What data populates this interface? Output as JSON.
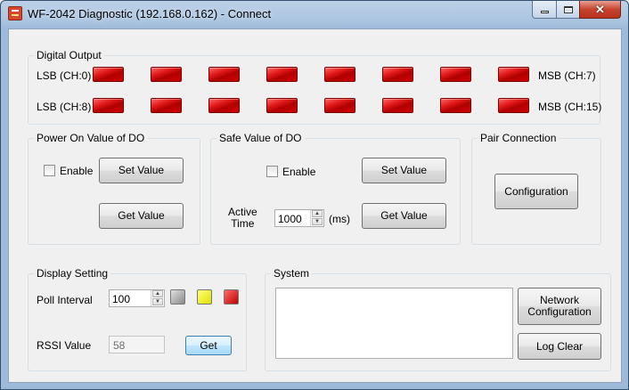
{
  "window": {
    "title": "WF-2042 Diagnostic (192.168.0.162) - Connect",
    "icon": "app-icon"
  },
  "digital_output": {
    "title": "Digital Output",
    "row1": {
      "left_label": "LSB (CH:0)",
      "right_label": "MSB (CH:7)"
    },
    "row2": {
      "left_label": "LSB (CH:8)",
      "right_label": "MSB (CH:15)"
    },
    "led_color": "#d40000",
    "led_count_per_row": 8
  },
  "power_on": {
    "title": "Power On Value of DO",
    "enable_label": "Enable",
    "enable_checked": false,
    "set_label": "Set Value",
    "get_label": "Get Value"
  },
  "safe_value": {
    "title": "Safe Value of DO",
    "enable_label": "Enable",
    "enable_checked": false,
    "set_label": "Set Value",
    "active_time_label": "Active\nTime",
    "active_time_value": "1000",
    "unit_label": "(ms)",
    "get_label": "Get Value"
  },
  "pair_connection": {
    "title": "Pair Connection",
    "config_label": "Configuration"
  },
  "display_setting": {
    "title": "Display Setting",
    "poll_label": "Poll Interval",
    "poll_value": "100",
    "swatch_colors": [
      "#9a9a9a",
      "#f2f200",
      "#d40000"
    ],
    "rssi_label": "RSSI Value",
    "rssi_value": "58",
    "get_label": "Get"
  },
  "system": {
    "title": "System",
    "log_text": "",
    "network_label": "Network\nConfiguration",
    "log_clear_label": "Log Clear"
  }
}
